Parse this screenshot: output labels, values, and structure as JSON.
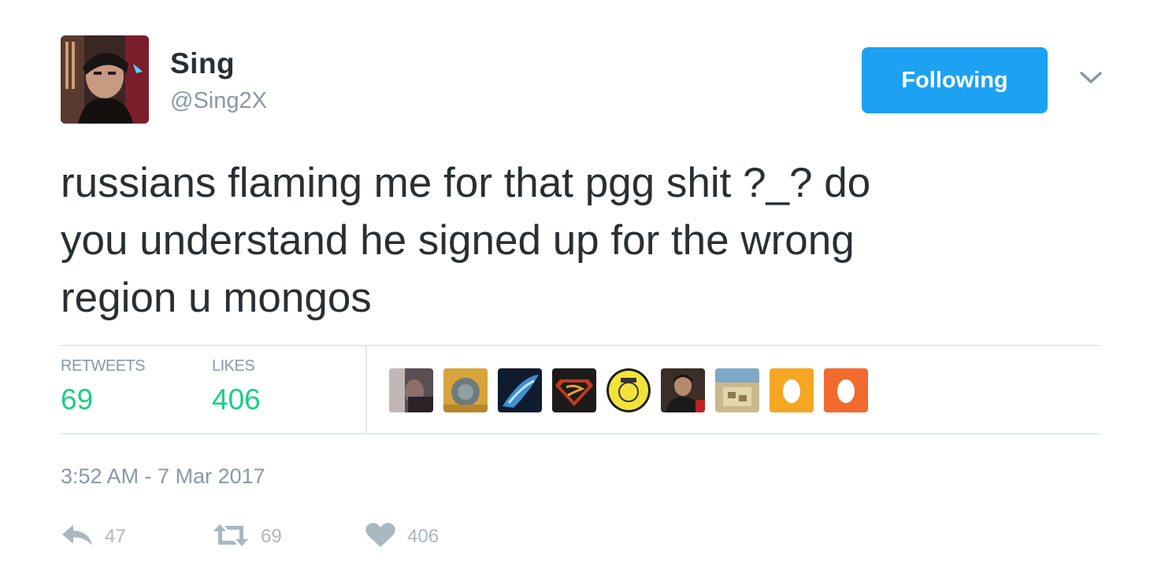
{
  "author": {
    "name": "Sing",
    "handle": "@Sing2X"
  },
  "follow_button": {
    "label": "Following",
    "color": "#1da1f2"
  },
  "caret_icon": "chevron-down-icon",
  "tweet": {
    "line1": "russians flaming me for that pgg shit ?_? do",
    "line2": "you understand he signed up for the wrong",
    "line3": "region u mongos"
  },
  "stats": {
    "retweets_label": "RETWEETS",
    "retweets_value": "69",
    "likes_label": "LIKES",
    "likes_value": "406",
    "accent": "#19cf86"
  },
  "likers_count_shown": 9,
  "timestamp": "3:52 AM - 7 Mar 2017",
  "actions": {
    "reply_icon": "reply-icon",
    "reply_count": "47",
    "retweet_icon": "retweet-icon",
    "retweet_count": "69",
    "like_icon": "heart-icon",
    "like_count": "406"
  }
}
